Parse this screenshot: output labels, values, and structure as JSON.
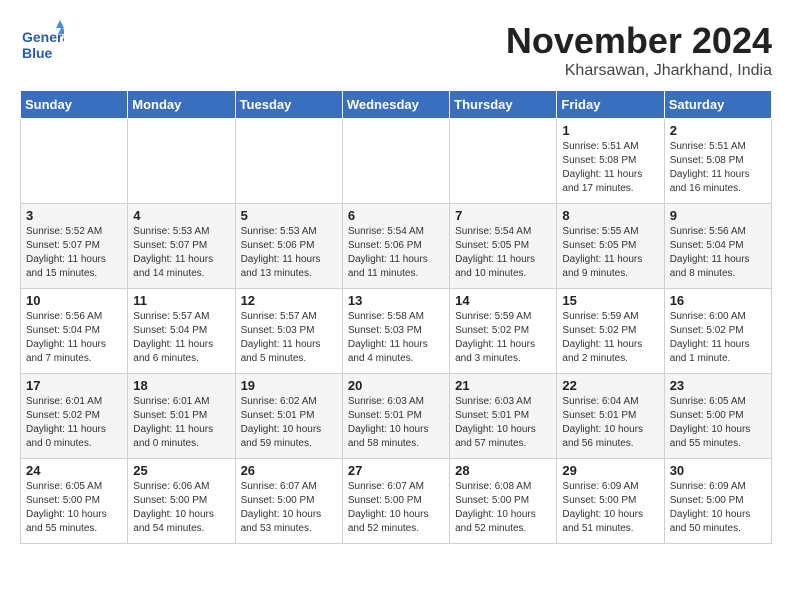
{
  "logo": {
    "line1": "General",
    "line2": "Blue"
  },
  "title": "November 2024",
  "subtitle": "Kharsawan, Jharkhand, India",
  "weekdays": [
    "Sunday",
    "Monday",
    "Tuesday",
    "Wednesday",
    "Thursday",
    "Friday",
    "Saturday"
  ],
  "weeks": [
    [
      {
        "day": "",
        "detail": ""
      },
      {
        "day": "",
        "detail": ""
      },
      {
        "day": "",
        "detail": ""
      },
      {
        "day": "",
        "detail": ""
      },
      {
        "day": "",
        "detail": ""
      },
      {
        "day": "1",
        "detail": "Sunrise: 5:51 AM\nSunset: 5:08 PM\nDaylight: 11 hours\nand 17 minutes."
      },
      {
        "day": "2",
        "detail": "Sunrise: 5:51 AM\nSunset: 5:08 PM\nDaylight: 11 hours\nand 16 minutes."
      }
    ],
    [
      {
        "day": "3",
        "detail": "Sunrise: 5:52 AM\nSunset: 5:07 PM\nDaylight: 11 hours\nand 15 minutes."
      },
      {
        "day": "4",
        "detail": "Sunrise: 5:53 AM\nSunset: 5:07 PM\nDaylight: 11 hours\nand 14 minutes."
      },
      {
        "day": "5",
        "detail": "Sunrise: 5:53 AM\nSunset: 5:06 PM\nDaylight: 11 hours\nand 13 minutes."
      },
      {
        "day": "6",
        "detail": "Sunrise: 5:54 AM\nSunset: 5:06 PM\nDaylight: 11 hours\nand 11 minutes."
      },
      {
        "day": "7",
        "detail": "Sunrise: 5:54 AM\nSunset: 5:05 PM\nDaylight: 11 hours\nand 10 minutes."
      },
      {
        "day": "8",
        "detail": "Sunrise: 5:55 AM\nSunset: 5:05 PM\nDaylight: 11 hours\nand 9 minutes."
      },
      {
        "day": "9",
        "detail": "Sunrise: 5:56 AM\nSunset: 5:04 PM\nDaylight: 11 hours\nand 8 minutes."
      }
    ],
    [
      {
        "day": "10",
        "detail": "Sunrise: 5:56 AM\nSunset: 5:04 PM\nDaylight: 11 hours\nand 7 minutes."
      },
      {
        "day": "11",
        "detail": "Sunrise: 5:57 AM\nSunset: 5:04 PM\nDaylight: 11 hours\nand 6 minutes."
      },
      {
        "day": "12",
        "detail": "Sunrise: 5:57 AM\nSunset: 5:03 PM\nDaylight: 11 hours\nand 5 minutes."
      },
      {
        "day": "13",
        "detail": "Sunrise: 5:58 AM\nSunset: 5:03 PM\nDaylight: 11 hours\nand 4 minutes."
      },
      {
        "day": "14",
        "detail": "Sunrise: 5:59 AM\nSunset: 5:02 PM\nDaylight: 11 hours\nand 3 minutes."
      },
      {
        "day": "15",
        "detail": "Sunrise: 5:59 AM\nSunset: 5:02 PM\nDaylight: 11 hours\nand 2 minutes."
      },
      {
        "day": "16",
        "detail": "Sunrise: 6:00 AM\nSunset: 5:02 PM\nDaylight: 11 hours\nand 1 minute."
      }
    ],
    [
      {
        "day": "17",
        "detail": "Sunrise: 6:01 AM\nSunset: 5:02 PM\nDaylight: 11 hours\nand 0 minutes."
      },
      {
        "day": "18",
        "detail": "Sunrise: 6:01 AM\nSunset: 5:01 PM\nDaylight: 11 hours\nand 0 minutes."
      },
      {
        "day": "19",
        "detail": "Sunrise: 6:02 AM\nSunset: 5:01 PM\nDaylight: 10 hours\nand 59 minutes."
      },
      {
        "day": "20",
        "detail": "Sunrise: 6:03 AM\nSunset: 5:01 PM\nDaylight: 10 hours\nand 58 minutes."
      },
      {
        "day": "21",
        "detail": "Sunrise: 6:03 AM\nSunset: 5:01 PM\nDaylight: 10 hours\nand 57 minutes."
      },
      {
        "day": "22",
        "detail": "Sunrise: 6:04 AM\nSunset: 5:01 PM\nDaylight: 10 hours\nand 56 minutes."
      },
      {
        "day": "23",
        "detail": "Sunrise: 6:05 AM\nSunset: 5:00 PM\nDaylight: 10 hours\nand 55 minutes."
      }
    ],
    [
      {
        "day": "24",
        "detail": "Sunrise: 6:05 AM\nSunset: 5:00 PM\nDaylight: 10 hours\nand 55 minutes."
      },
      {
        "day": "25",
        "detail": "Sunrise: 6:06 AM\nSunset: 5:00 PM\nDaylight: 10 hours\nand 54 minutes."
      },
      {
        "day": "26",
        "detail": "Sunrise: 6:07 AM\nSunset: 5:00 PM\nDaylight: 10 hours\nand 53 minutes."
      },
      {
        "day": "27",
        "detail": "Sunrise: 6:07 AM\nSunset: 5:00 PM\nDaylight: 10 hours\nand 52 minutes."
      },
      {
        "day": "28",
        "detail": "Sunrise: 6:08 AM\nSunset: 5:00 PM\nDaylight: 10 hours\nand 52 minutes."
      },
      {
        "day": "29",
        "detail": "Sunrise: 6:09 AM\nSunset: 5:00 PM\nDaylight: 10 hours\nand 51 minutes."
      },
      {
        "day": "30",
        "detail": "Sunrise: 6:09 AM\nSunset: 5:00 PM\nDaylight: 10 hours\nand 50 minutes."
      }
    ]
  ]
}
